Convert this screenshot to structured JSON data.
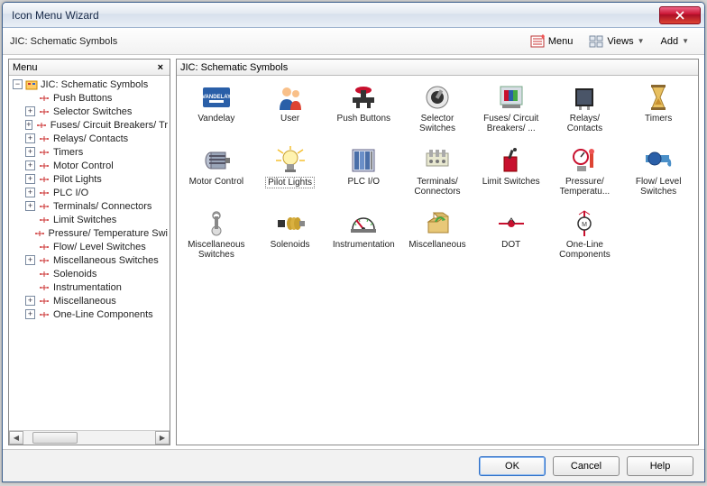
{
  "window": {
    "title": "Icon Menu Wizard"
  },
  "toolbar": {
    "breadcrumb": "JIC: Schematic Symbols",
    "menu_label": "Menu",
    "views_label": "Views",
    "add_label": "Add"
  },
  "sidebar": {
    "header": "Menu",
    "root": {
      "label": "JIC: Schematic Symbols",
      "expanded": true
    },
    "items": [
      {
        "label": "Push Buttons",
        "toggle": "none"
      },
      {
        "label": "Selector Switches",
        "toggle": "plus"
      },
      {
        "label": "Fuses/ Circuit Breakers/ Tr",
        "toggle": "plus"
      },
      {
        "label": "Relays/ Contacts",
        "toggle": "plus"
      },
      {
        "label": "Timers",
        "toggle": "plus"
      },
      {
        "label": "Motor Control",
        "toggle": "plus"
      },
      {
        "label": "Pilot Lights",
        "toggle": "plus"
      },
      {
        "label": "PLC I/O",
        "toggle": "plus"
      },
      {
        "label": "Terminals/ Connectors",
        "toggle": "plus"
      },
      {
        "label": "Limit Switches",
        "toggle": "none"
      },
      {
        "label": "Pressure/ Temperature Swi",
        "toggle": "none"
      },
      {
        "label": "Flow/ Level Switches",
        "toggle": "none"
      },
      {
        "label": "Miscellaneous Switches",
        "toggle": "plus"
      },
      {
        "label": "Solenoids",
        "toggle": "none"
      },
      {
        "label": "Instrumentation",
        "toggle": "none"
      },
      {
        "label": "Miscellaneous",
        "toggle": "plus"
      },
      {
        "label": "One-Line Components",
        "toggle": "plus"
      }
    ]
  },
  "main": {
    "header": "JIC: Schematic Symbols",
    "items": [
      {
        "label": "Vandelay",
        "icon": "vandelay"
      },
      {
        "label": "User",
        "icon": "user"
      },
      {
        "label": "Push Buttons",
        "icon": "pushbutton"
      },
      {
        "label": "Selector Switches",
        "icon": "selector"
      },
      {
        "label": "Fuses/ Circuit Breakers/ ...",
        "icon": "fuses"
      },
      {
        "label": "Relays/ Contacts",
        "icon": "relays"
      },
      {
        "label": "Timers",
        "icon": "timers"
      },
      {
        "label": "Motor Control",
        "icon": "motor"
      },
      {
        "label": "Pilot Lights",
        "icon": "pilot",
        "selected": true
      },
      {
        "label": "PLC I/O",
        "icon": "plc"
      },
      {
        "label": "Terminals/ Connectors",
        "icon": "terminals"
      },
      {
        "label": "Limit Switches",
        "icon": "limit"
      },
      {
        "label": "Pressure/ Temperatu...",
        "icon": "pressure"
      },
      {
        "label": "Flow/ Level Switches",
        "icon": "flow"
      },
      {
        "label": "Miscellaneous Switches",
        "icon": "misc-sw"
      },
      {
        "label": "Solenoids",
        "icon": "solenoid"
      },
      {
        "label": "Instrumentation",
        "icon": "instrument"
      },
      {
        "label": "Miscellaneous",
        "icon": "misc"
      },
      {
        "label": "DOT",
        "icon": "dot"
      },
      {
        "label": "One-Line Components",
        "icon": "oneline"
      }
    ]
  },
  "footer": {
    "ok": "OK",
    "cancel": "Cancel",
    "help": "Help"
  }
}
